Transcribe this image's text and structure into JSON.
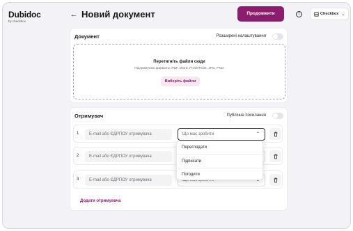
{
  "brand": {
    "name": "Dubidoc",
    "sub": "by checkbox"
  },
  "header": {
    "back_icon": "arrow-left-icon",
    "title": "Новий документ",
    "continue_label": "Продовжити",
    "info_icon": "info-icon",
    "company": "Checkbox",
    "accent": "#8c1d6c"
  },
  "document": {
    "title": "Документ",
    "advanced_label": "Розширені налаштування",
    "drop_title": "Перетягніть файли сюди",
    "drop_sub": "Підтримуємо формати: PDF, Word, PowerPoint, JPG, PNG",
    "choose_label": "Виберіть файли"
  },
  "recipients": {
    "title": "Отримувач",
    "public_label": "Публічне посилання",
    "rows": [
      {
        "num": "1",
        "email_placeholder": "E-mail або ЄДРПОУ отримувача",
        "action_placeholder": "Що має зробити"
      },
      {
        "num": "2",
        "email_placeholder": "E-mail або ЄДРПОУ отримувача",
        "action_placeholder": ""
      },
      {
        "num": "3",
        "email_placeholder": "E-mail або ЄДРПОУ отримувача",
        "action_placeholder": "Що має зробити"
      }
    ],
    "add_label": "Додати отримувача"
  },
  "action_menu": {
    "options": [
      "Переглядати",
      "Підписати",
      "Погодити"
    ]
  }
}
